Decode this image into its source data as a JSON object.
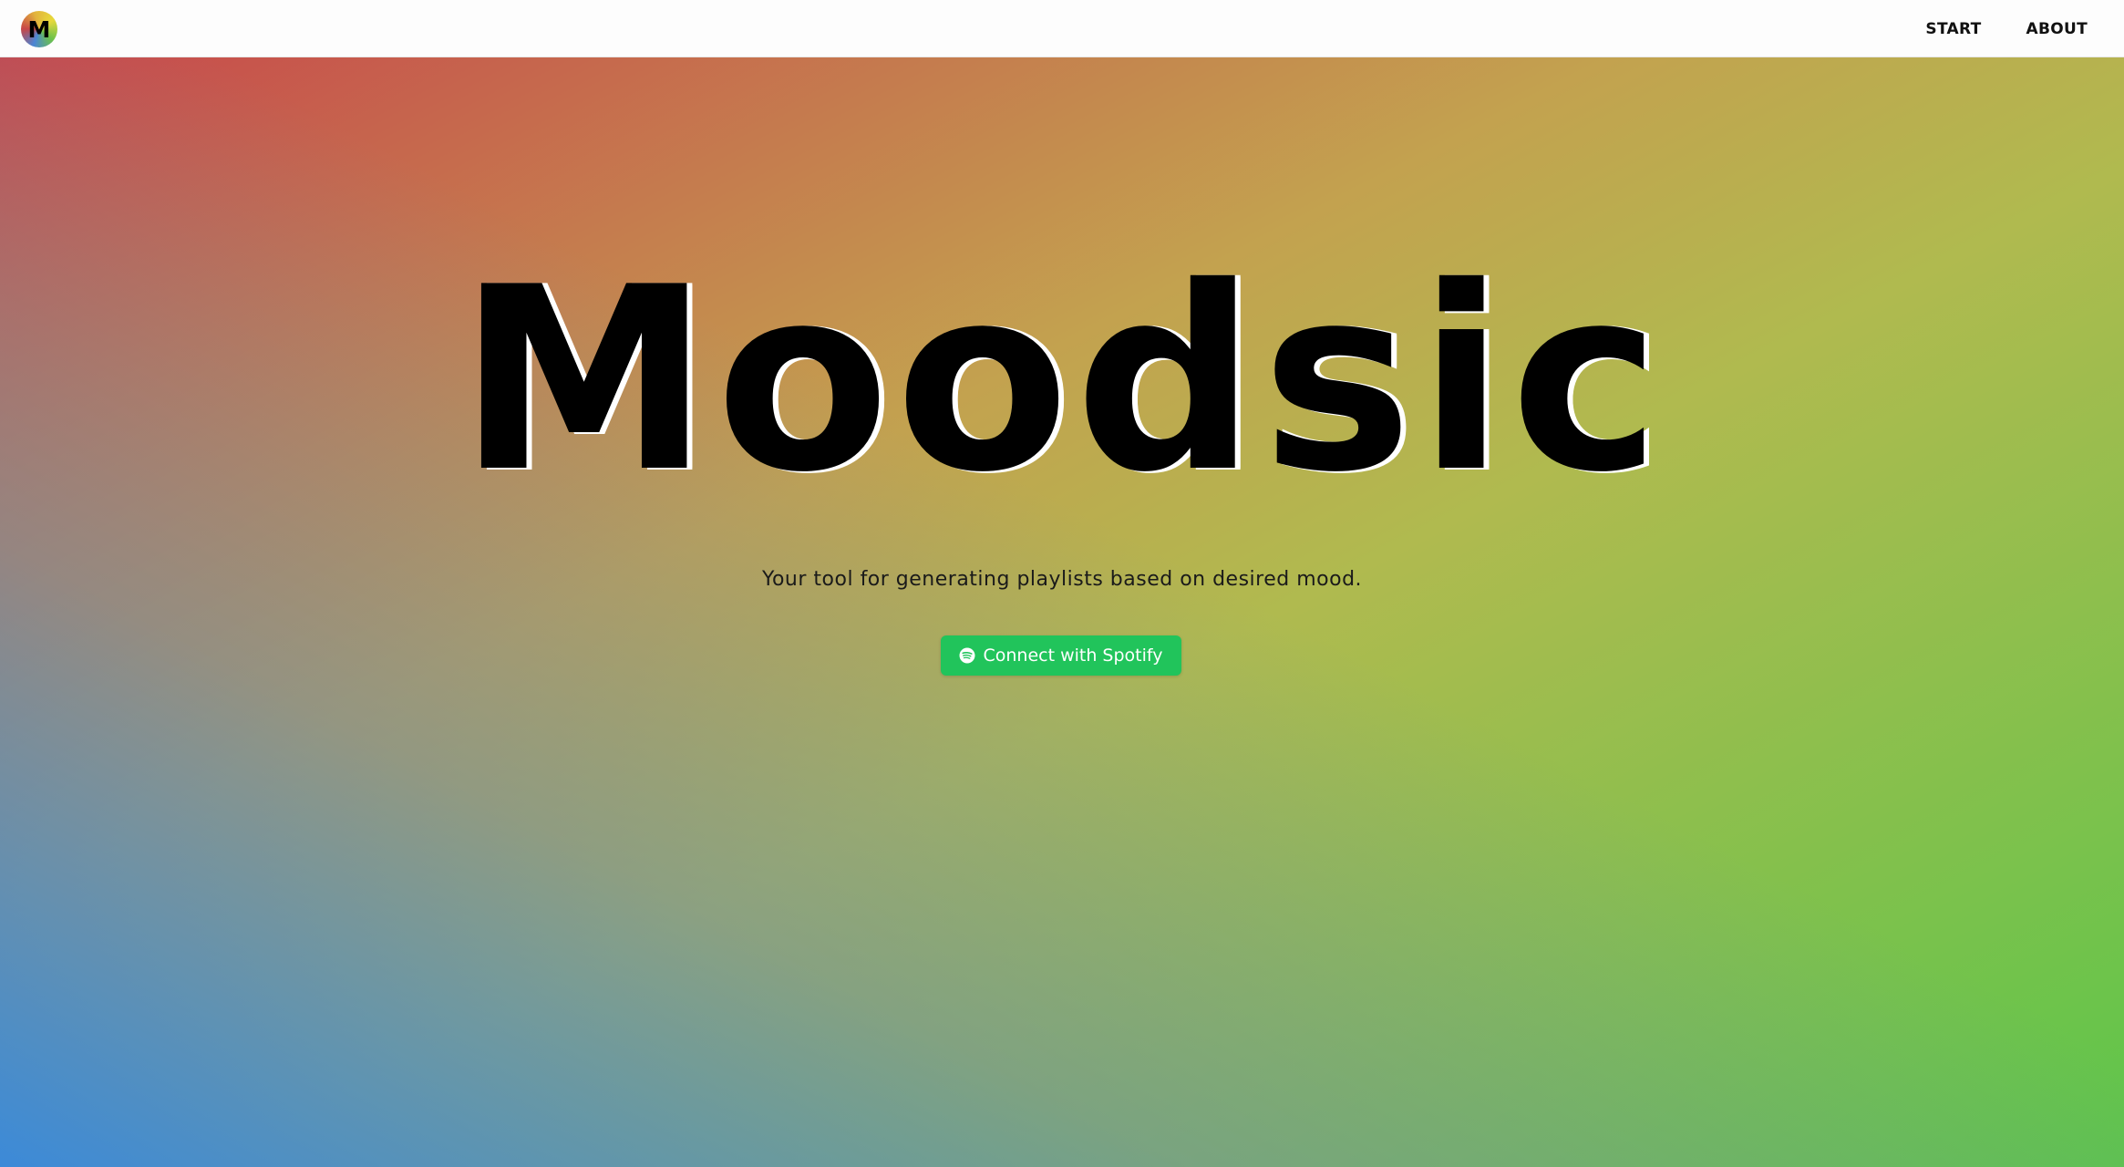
{
  "navbar": {
    "logo_letter": "M",
    "links": [
      {
        "label": "START"
      },
      {
        "label": "ABOUT"
      }
    ]
  },
  "hero": {
    "title": "Moodsic",
    "subtitle": "Your tool for generating playlists based on desired mood.",
    "cta_label": "Connect with Spotify",
    "cta_icon": "spotify-icon"
  },
  "colors": {
    "cta_bg": "#21c45b",
    "gradient_top_left": "#c8474c",
    "gradient_top_right": "#e7d93b",
    "gradient_bottom_left": "#3c8ad8",
    "gradient_bottom_right": "#5dc64a"
  }
}
